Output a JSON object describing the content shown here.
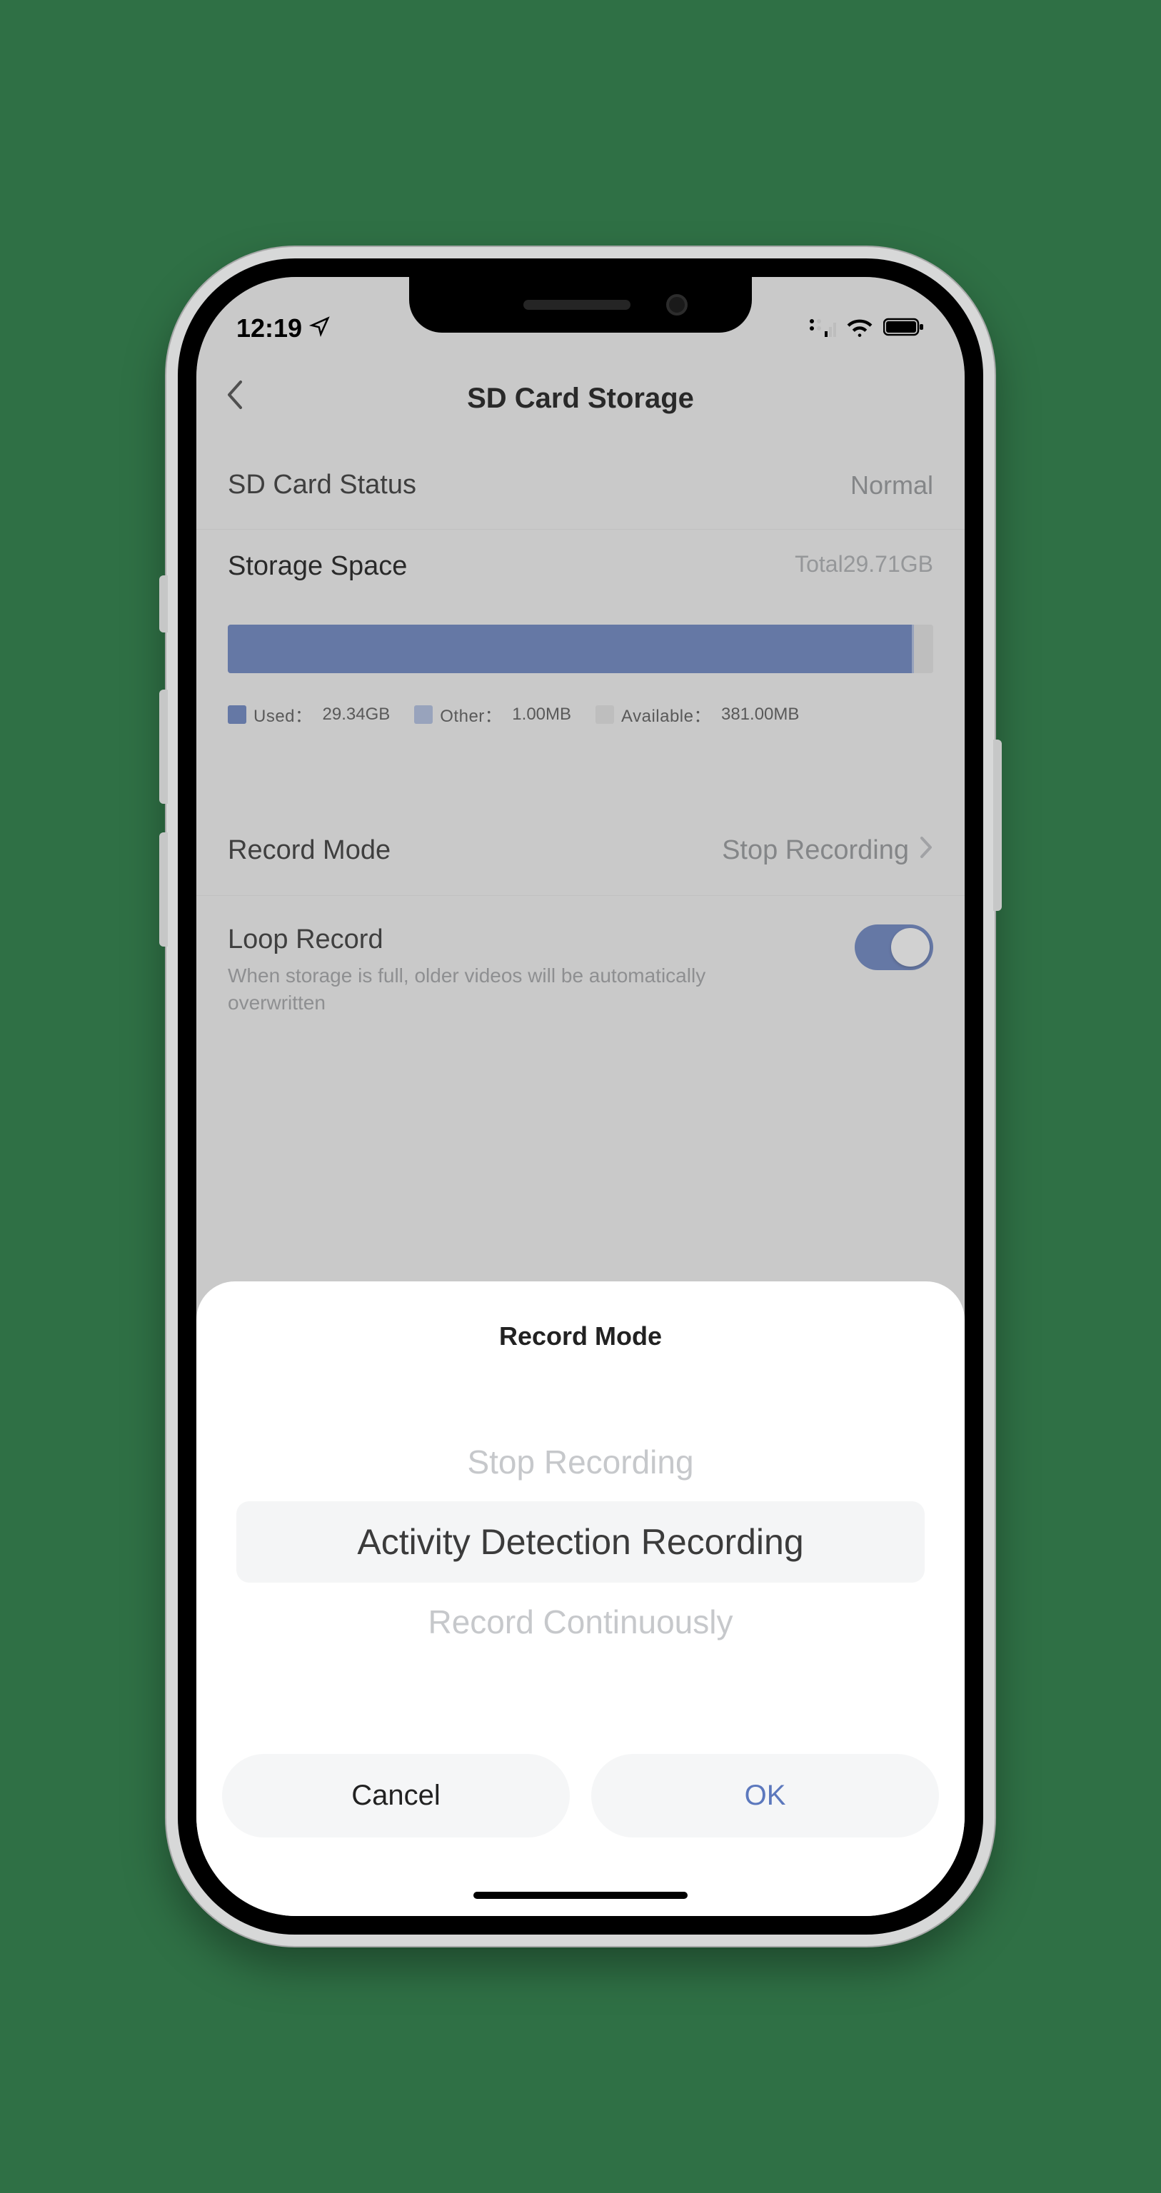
{
  "status": {
    "time": "12:19"
  },
  "nav": {
    "title": "SD Card Storage"
  },
  "sd_status": {
    "label": "SD Card Status",
    "value": "Normal"
  },
  "storage": {
    "label": "Storage Space",
    "total_label": "Total29.71GB",
    "used_label": "Used：",
    "used_value": "29.34GB",
    "other_label": "Other：",
    "other_value": "1.00MB",
    "available_label": "Available：",
    "available_value": "381.00MB",
    "used_pct": 97,
    "other_pct": 0.3,
    "avail_pct": 2.7
  },
  "record_mode": {
    "label": "Record Mode",
    "value": "Stop Recording"
  },
  "loop": {
    "title": "Loop Record",
    "desc": "When storage is full, older videos will be automatically overwritten",
    "on": true
  },
  "sheet": {
    "title": "Record Mode",
    "options": [
      "Stop Recording",
      "Activity Detection Recording",
      "Record Continuously"
    ],
    "selected_index": 1,
    "cancel": "Cancel",
    "ok": "OK"
  }
}
